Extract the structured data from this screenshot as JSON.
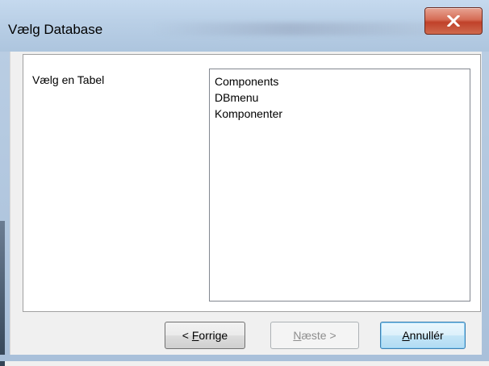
{
  "window": {
    "title": "Vælg Database",
    "close_icon": "close-x-icon"
  },
  "prompt": {
    "label": "Vælg en Tabel"
  },
  "tables": {
    "items": [
      "Components",
      "DBmenu",
      "Komponenter"
    ]
  },
  "buttons": {
    "previous": {
      "prefix": "< ",
      "mnemonic": "F",
      "rest": "orrige",
      "enabled": true
    },
    "next": {
      "mnemonic": "N",
      "rest": "æste >",
      "enabled": false
    },
    "cancel": {
      "mnemonic": "A",
      "rest": "nnullér",
      "enabled": true,
      "default": true
    }
  },
  "colors": {
    "close_button": "#c9543c",
    "titlebar": "#b9cfe6",
    "dialog_bg": "#f0f0f0",
    "disabled_text": "#8d8d8d"
  }
}
